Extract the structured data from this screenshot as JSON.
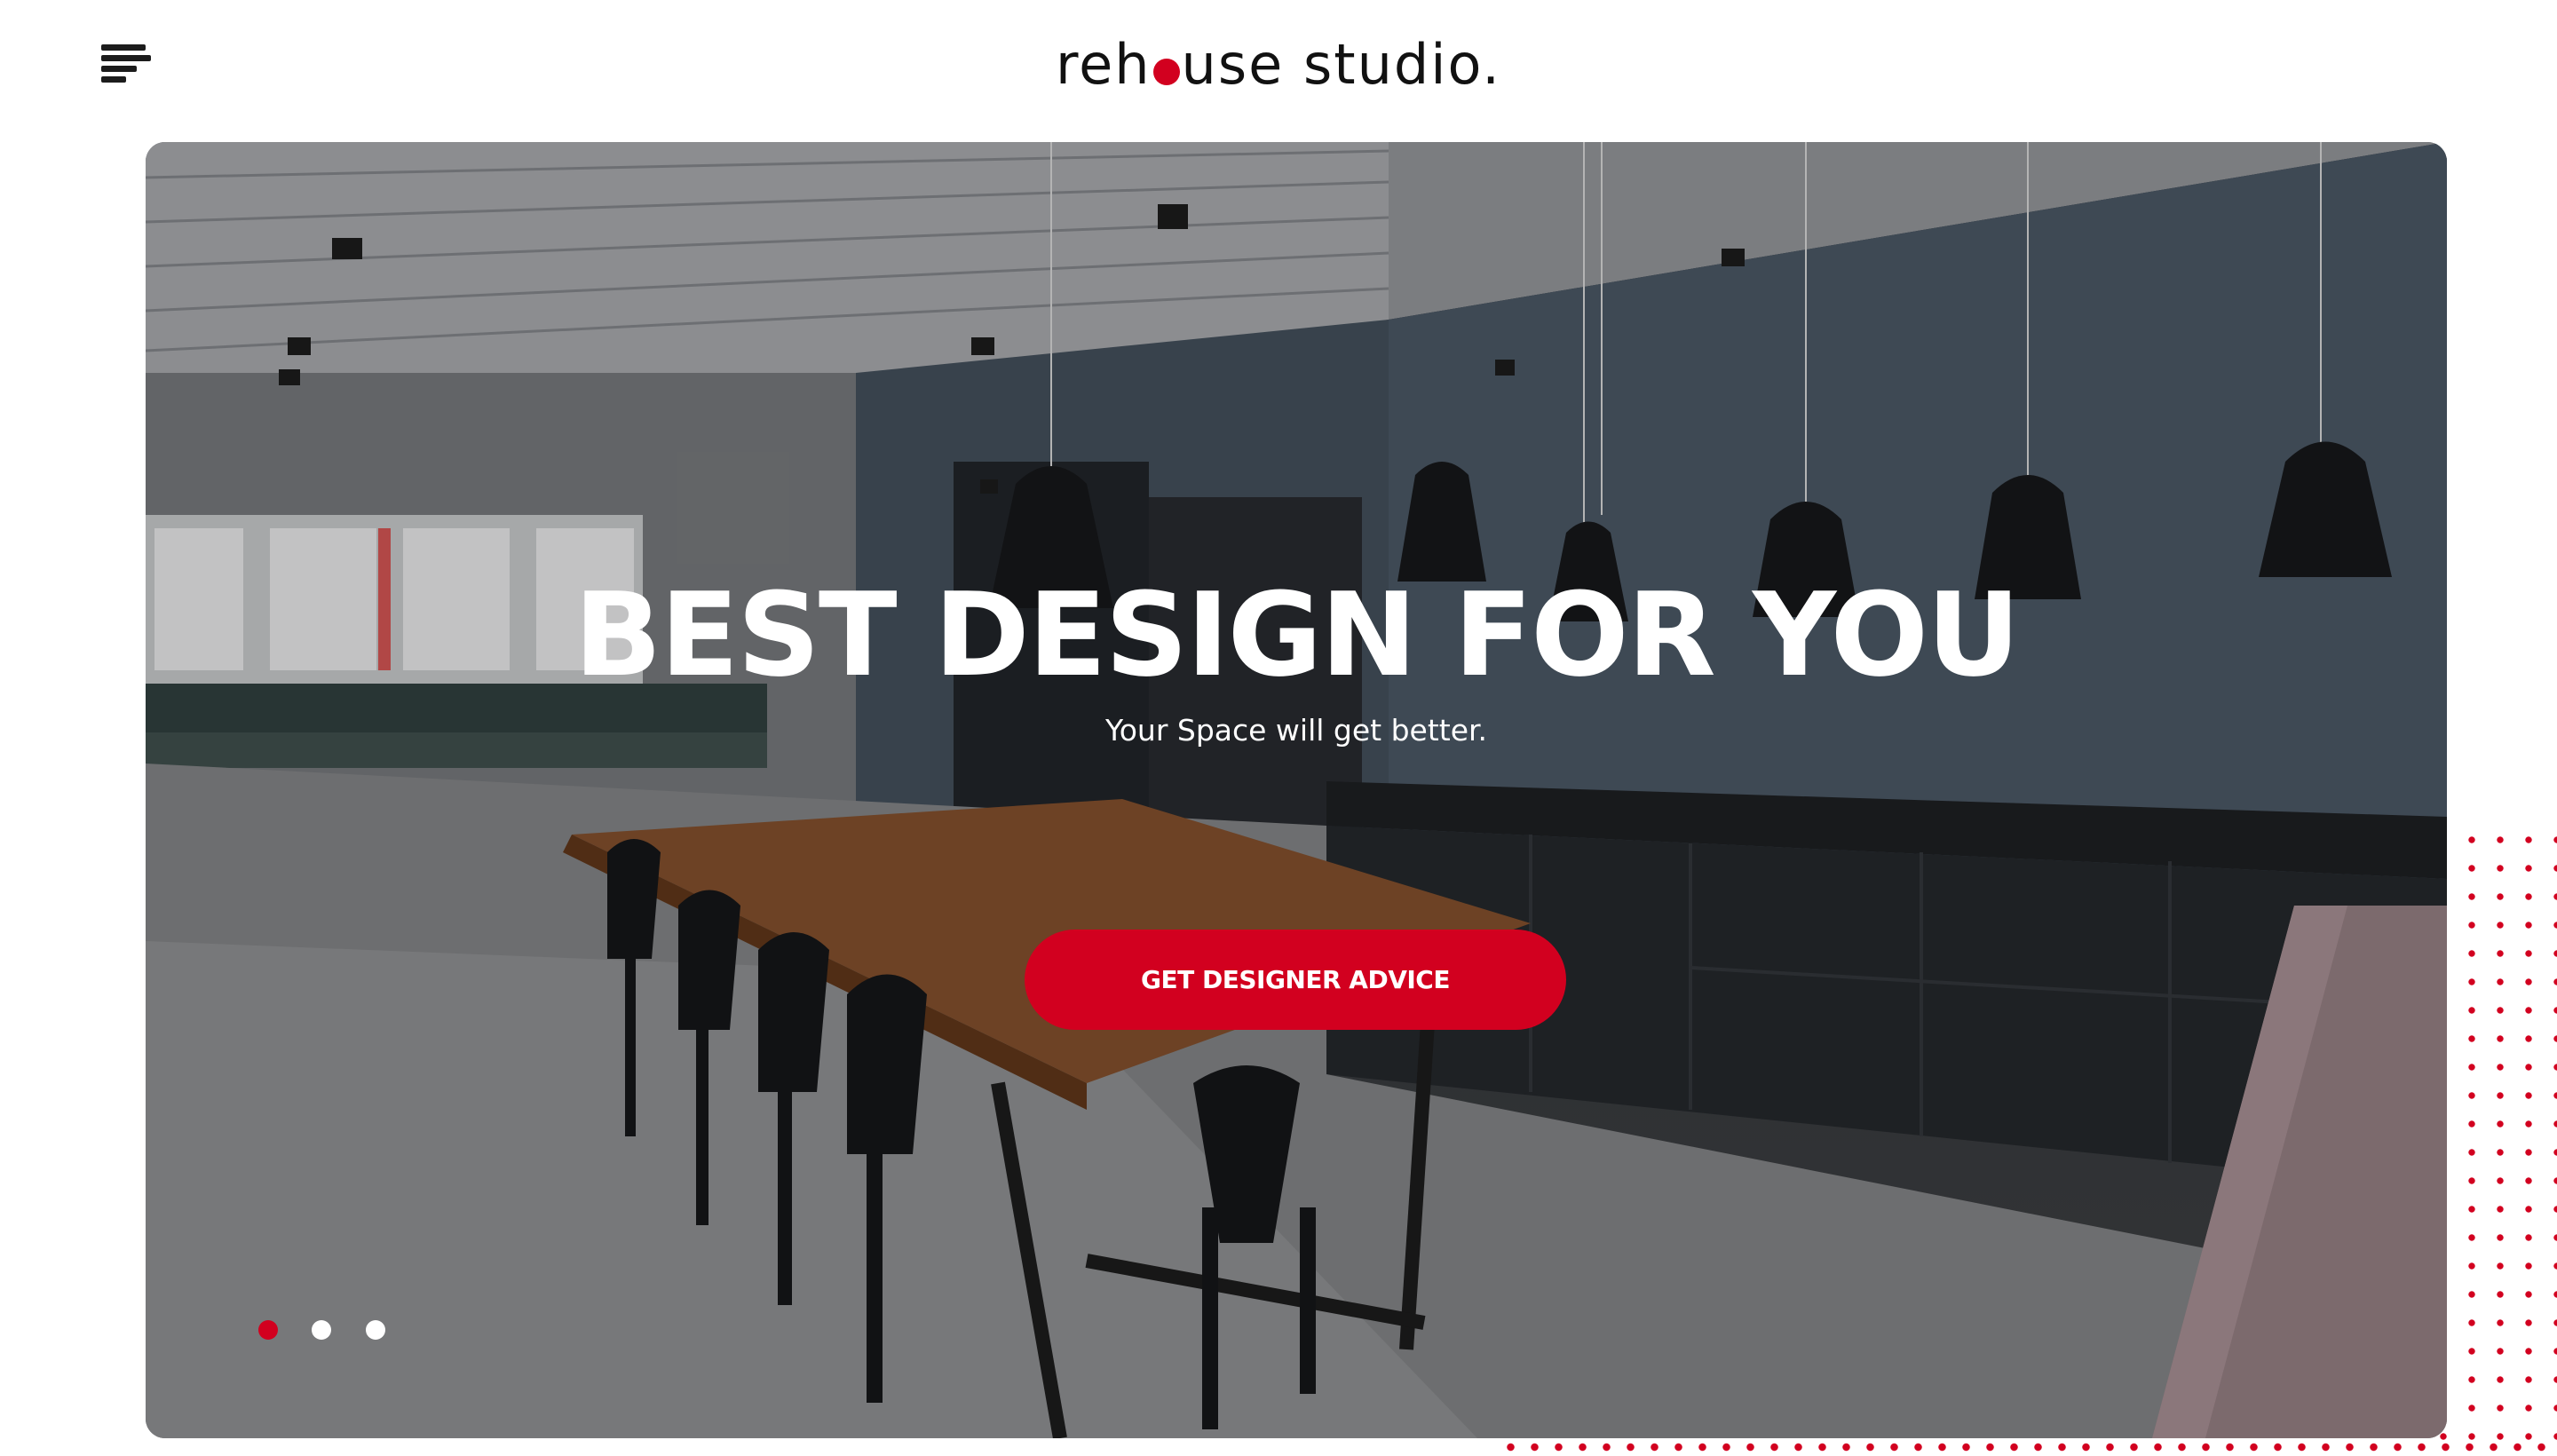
{
  "brand": {
    "name_before_dot": "reh",
    "name_after_dot": "use studio.",
    "accent_color": "#d2001f"
  },
  "header": {
    "menu_icon": "hamburger-menu-icon"
  },
  "hero": {
    "headline": "BEST DESIGN FOR YOU",
    "subline": "Your Space will get better.",
    "cta_label": "GET DESIGNER ADVICE",
    "image_icon": "kitchen-interior-photo",
    "slides": {
      "count": 3,
      "active_index": 0
    }
  }
}
